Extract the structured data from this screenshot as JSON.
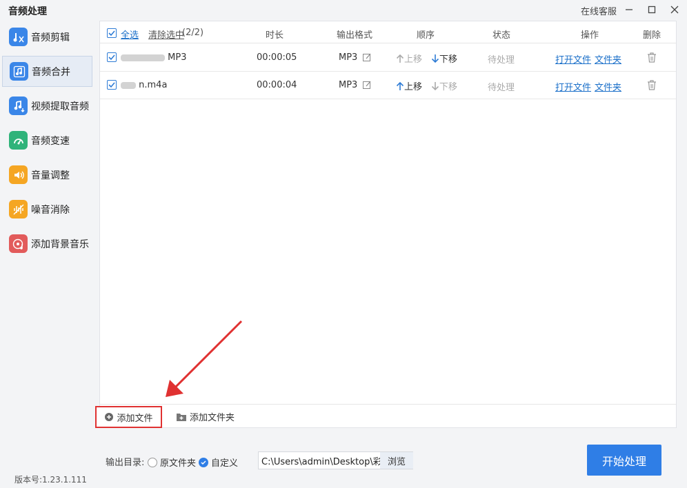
{
  "app": {
    "title": "音频处理",
    "service": "在线客服"
  },
  "sidebar": {
    "items": [
      {
        "label": "音频剪辑",
        "icon": "audio-cut-icon",
        "color": "#3a86e8",
        "active": false
      },
      {
        "label": "音频合并",
        "icon": "audio-merge-icon",
        "color": "#3a86e8",
        "active": true
      },
      {
        "label": "视频提取音频",
        "icon": "video-extract-audio-icon",
        "color": "#3a86e8",
        "active": false
      },
      {
        "label": "音频变速",
        "icon": "audio-speed-icon",
        "color": "#2fb37a",
        "active": false
      },
      {
        "label": "音量调整",
        "icon": "volume-icon",
        "color": "#f5a623",
        "active": false
      },
      {
        "label": "噪音消除",
        "icon": "noise-reduce-icon",
        "color": "#f5a623",
        "active": false
      },
      {
        "label": "添加背景音乐",
        "icon": "background-music-icon",
        "color": "#e25b5b",
        "active": false
      }
    ]
  },
  "table": {
    "select_all": "全选",
    "clear_selection": "清除选中",
    "selection_count": "(2/2)",
    "columns": {
      "duration": "时长",
      "format": "输出格式",
      "order": "顺序",
      "status": "状态",
      "actions": "操作",
      "delete": "删除"
    },
    "rows": [
      {
        "name_suffix": "MP3",
        "duration": "00:00:05",
        "format": "MP3",
        "move_up": "上移",
        "move_down": "下移",
        "up_enabled": false,
        "down_enabled": true,
        "status": "待处理",
        "open_file": "打开文件",
        "open_folder": "文件夹"
      },
      {
        "name_suffix": "n.m4a",
        "duration": "00:00:04",
        "format": "MP3",
        "move_up": "上移",
        "move_down": "下移",
        "up_enabled": true,
        "down_enabled": false,
        "status": "待处理",
        "open_file": "打开文件",
        "open_folder": "文件夹"
      }
    ]
  },
  "footer": {
    "add_file": "添加文件",
    "add_folder": "添加文件夹"
  },
  "output": {
    "label": "输出目录:",
    "option_original": "原文件夹",
    "option_custom": "自定义",
    "selected": "custom",
    "path": "C:\\Users\\admin\\Desktop\\彩",
    "browse": "浏览"
  },
  "start_button": "开始处理",
  "version": "版本号:1.23.1.111",
  "colors": {
    "accent": "#2f7ee6",
    "link": "#1a6fc9",
    "annotation": "#e03131"
  }
}
